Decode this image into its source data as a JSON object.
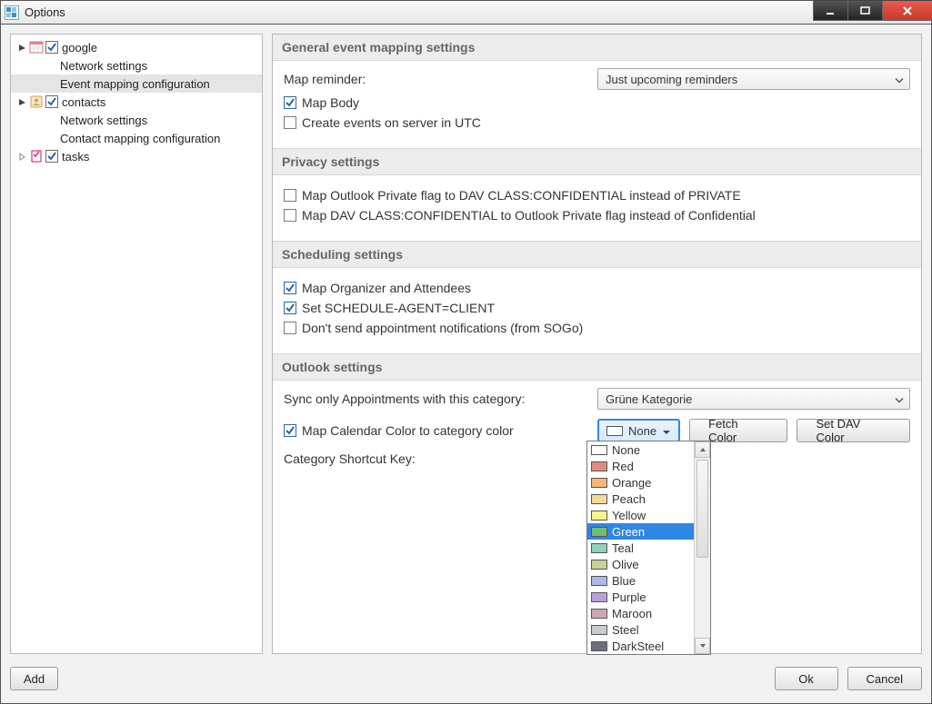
{
  "window": {
    "title": "Options"
  },
  "tree": {
    "google": {
      "label": "google",
      "net": "Network settings",
      "map": "Event mapping configuration"
    },
    "contacts": {
      "label": "contacts",
      "net": "Network settings",
      "map": "Contact mapping configuration"
    },
    "tasks": {
      "label": "tasks"
    }
  },
  "sections": {
    "general": {
      "header": "General event mapping settings",
      "map_reminder_label": "Map reminder:",
      "map_reminder_value": "Just upcoming reminders",
      "map_body": "Map Body",
      "create_utc": "Create events on server in UTC"
    },
    "privacy": {
      "header": "Privacy settings",
      "opt1": "Map Outlook Private flag to DAV CLASS:CONFIDENTIAL instead of PRIVATE",
      "opt2": "Map DAV CLASS:CONFIDENTIAL to Outlook Private flag instead of Confidential"
    },
    "scheduling": {
      "header": "Scheduling settings",
      "opt1": "Map Organizer and Attendees",
      "opt2": "Set SCHEDULE-AGENT=CLIENT",
      "opt3": "Don't send appointment notifications (from SOGo)"
    },
    "outlook": {
      "header": "Outlook settings",
      "sync_label": "Sync only Appointments with this category:",
      "sync_value": "Grüne Kategorie",
      "map_color": "Map Calendar Color to category color",
      "shortcut_label": "Category Shortcut Key:",
      "color_btn": "None",
      "fetch_btn": "Fetch Color",
      "setdav_btn": "Set DAV Color"
    }
  },
  "colors": {
    "items": [
      {
        "name": "None",
        "hex": "#ffffff"
      },
      {
        "name": "Red",
        "hex": "#e18a84"
      },
      {
        "name": "Orange",
        "hex": "#f4b776"
      },
      {
        "name": "Peach",
        "hex": "#f6d89a"
      },
      {
        "name": "Yellow",
        "hex": "#f9f48a"
      },
      {
        "name": "Green",
        "hex": "#6fbf73"
      },
      {
        "name": "Teal",
        "hex": "#8fd0b7"
      },
      {
        "name": "Olive",
        "hex": "#c8cf9a"
      },
      {
        "name": "Blue",
        "hex": "#a9b8e8"
      },
      {
        "name": "Purple",
        "hex": "#b8a1d8"
      },
      {
        "name": "Maroon",
        "hex": "#d0a5b5"
      },
      {
        "name": "Steel",
        "hex": "#c7cbd0"
      },
      {
        "name": "DarkSteel",
        "hex": "#6a7079"
      }
    ],
    "selected_index": 5
  },
  "buttons": {
    "add": "Add",
    "ok": "Ok",
    "cancel": "Cancel"
  }
}
